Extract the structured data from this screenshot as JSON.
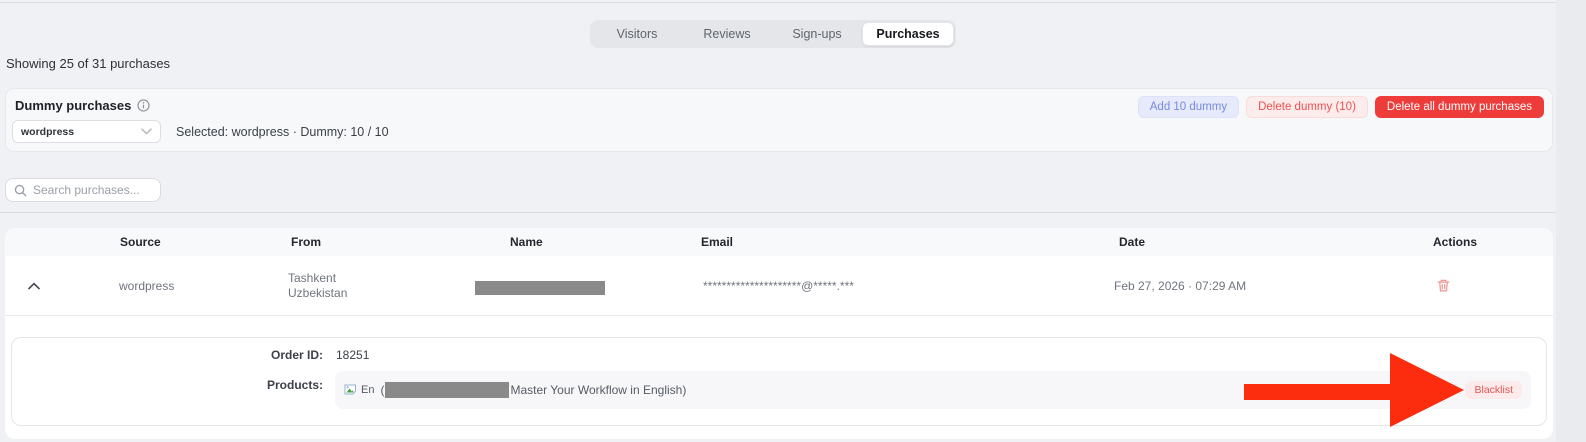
{
  "tabs": {
    "items": [
      {
        "label": "Visitors",
        "active": false
      },
      {
        "label": "Reviews",
        "active": false
      },
      {
        "label": "Sign-ups",
        "active": false
      },
      {
        "label": "Purchases",
        "active": true
      }
    ]
  },
  "summary": {
    "text": "Showing 25 of 31 purchases"
  },
  "dummy_panel": {
    "title": "Dummy purchases",
    "select": {
      "value": "wordpress"
    },
    "selected_info": "Selected: wordpress · Dummy: 10 / 10",
    "buttons": {
      "add": "Add 10 dummy",
      "delete": "Delete dummy (10)",
      "delete_all": "Delete all dummy purchases"
    }
  },
  "search": {
    "placeholder": "Search purchases..."
  },
  "table": {
    "headers": [
      "Source",
      "From",
      "Name",
      "Email",
      "Date",
      "Actions"
    ],
    "row": {
      "source": "wordpress",
      "from_line1": "Tashkent",
      "from_line2": "Uzbekistan",
      "email": "*********************@*****.***",
      "date": "Feb 27, 2026 · 07:29 AM"
    }
  },
  "expanded": {
    "order_id_label": "Order ID:",
    "order_id_value": "18251",
    "products_label": "Products:",
    "product": {
      "image_alt": "En",
      "title_prefix": "(",
      "title_suffix": "Master Your Workflow in English)",
      "blacklist": "Blacklist"
    }
  },
  "colors": {
    "accent_red": "#ee3c3a",
    "arrow_red": "#fc2d0e",
    "light_red_bg": "#fdecec",
    "red_text": "#ef5050",
    "light_blue_bg": "#e6eafb",
    "blue_text": "#7789dd",
    "redaction_gray": "#8a8a8a"
  }
}
